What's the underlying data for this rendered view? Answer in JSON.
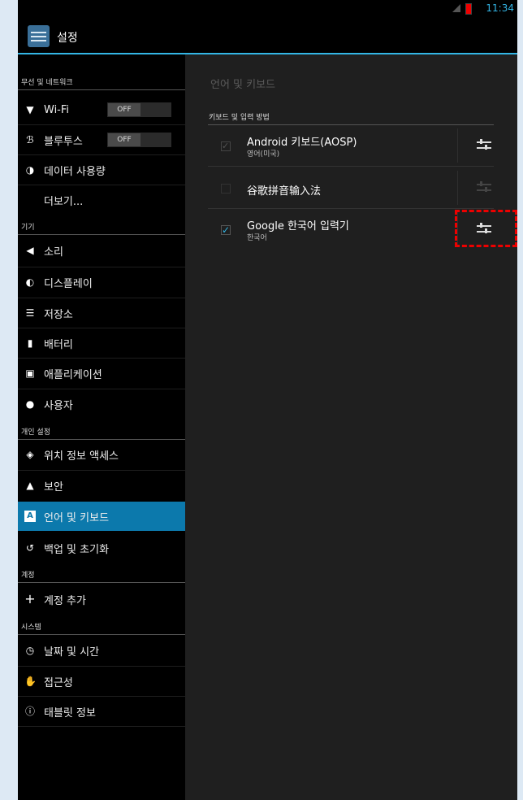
{
  "status_bar": {
    "time": "11:34"
  },
  "action_bar": {
    "title": "설정"
  },
  "left_pane": {
    "sections": {
      "wireless": "무선 및 네트워크",
      "device": "기기",
      "personal": "개인 설정",
      "accounts": "계정",
      "system": "시스템"
    },
    "items": {
      "wifi": "Wi-Fi",
      "bluetooth": "블루투스",
      "data_usage": "데이터 사용량",
      "more": "더보기...",
      "sound": "소리",
      "display": "디스플레이",
      "storage": "저장소",
      "battery": "배터리",
      "apps": "애플리케이션",
      "users": "사용자",
      "location": "위치 정보 액세스",
      "security": "보안",
      "language": "언어 및 키보드",
      "backup": "백업 및 초기화",
      "add_account": "계정 추가",
      "datetime": "날짜 및 시간",
      "accessibility": "접근성",
      "about": "태블릿 정보"
    },
    "wifi_toggle": "OFF",
    "bluetooth_toggle": "OFF",
    "active_item": "language"
  },
  "right_pane": {
    "title": "언어 및 키보드",
    "section": "키보드 및 입력 방법",
    "rows": [
      {
        "name": "Android 키보드(AOSP)",
        "sub": "영어(미국)",
        "checked": true,
        "enabled": false
      },
      {
        "name": "谷歌拼音输入法",
        "sub": "",
        "checked": false,
        "enabled": false
      },
      {
        "name": "Google 한국어 입력기",
        "sub": "한국어",
        "checked": true,
        "enabled": true
      }
    ]
  },
  "colors": {
    "accent": "#33b5e5",
    "active_bg": "#0c79ac",
    "highlight": "#ee0000"
  }
}
